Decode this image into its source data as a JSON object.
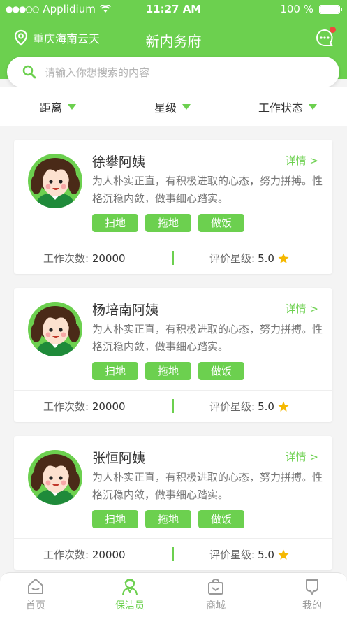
{
  "status_bar": {
    "carrier": "Applidium",
    "time": "11:27 AM",
    "battery": "100 %"
  },
  "header": {
    "location": "重庆海南云天",
    "title": "新内务府"
  },
  "search": {
    "placeholder": "请输入你想搜索的内容"
  },
  "filters": [
    "距离",
    "星级",
    "工作状态"
  ],
  "cards": [
    {
      "name": "徐攀阿姨",
      "detail": "详情 >",
      "description": "为人朴实正直，有积极进取的心态，努力拼搏。性格沉稳内敛，做事细心踏实。",
      "tags": [
        "扫地",
        "拖地",
        "做饭"
      ],
      "count_label": "工作次数:",
      "count": "20000",
      "rating_label": "评价星级:",
      "rating": "5.0"
    },
    {
      "name": "杨培南阿姨",
      "detail": "详情 >",
      "description": "为人朴实正直，有积极进取的心态，努力拼搏。性格沉稳内敛，做事细心踏实。",
      "tags": [
        "扫地",
        "拖地",
        "做饭"
      ],
      "count_label": "工作次数:",
      "count": "20000",
      "rating_label": "评价星级:",
      "rating": "5.0"
    },
    {
      "name": "张恒阿姨",
      "detail": "详情 >",
      "description": "为人朴实正直，有积极进取的心态，努力拼搏。性格沉稳内敛，做事细心踏实。",
      "tags": [
        "扫地",
        "拖地",
        "做饭"
      ],
      "count_label": "工作次数:",
      "count": "20000",
      "rating_label": "评价星级:",
      "rating": "5.0"
    }
  ],
  "tabbar": [
    {
      "label": "首页",
      "icon": "home-icon",
      "active": false
    },
    {
      "label": "保洁员",
      "icon": "cleaner-icon",
      "active": true
    },
    {
      "label": "商城",
      "icon": "shop-bag-icon",
      "active": false
    },
    {
      "label": "我的",
      "icon": "profile-icon",
      "active": false
    }
  ],
  "colors": {
    "primary": "#6cd04f",
    "star": "#f5b800",
    "badge": "#f0473e"
  }
}
